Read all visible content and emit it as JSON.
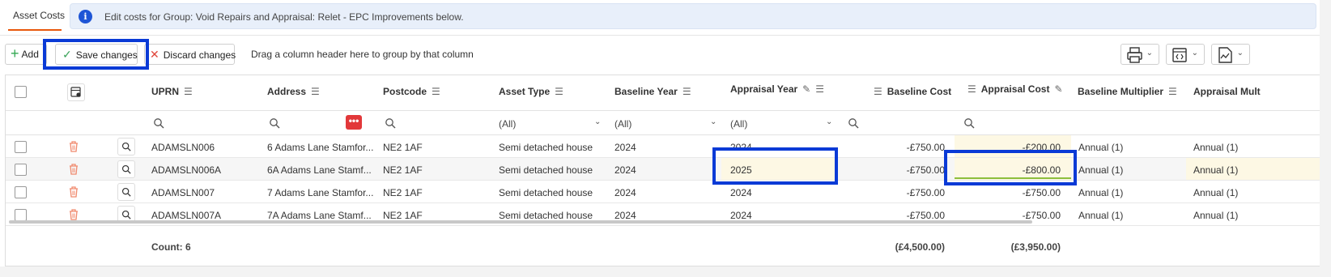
{
  "tab": {
    "label": "Asset Costs"
  },
  "banner": {
    "text": "Edit costs for Group: Void Repairs and Appraisal: Relet - EPC Improvements below.",
    "icon": "info-icon"
  },
  "toolbar": {
    "add_label": "Add",
    "save_label": "Save changes",
    "discard_label": "Discard changes",
    "group_hint": "Drag a column header here to group by that column"
  },
  "columns": {
    "uprn": "UPRN",
    "address": "Address",
    "postcode": "Postcode",
    "asset_type": "Asset Type",
    "baseline_year": "Baseline Year",
    "appraisal_year": "Appraisal Year",
    "baseline_cost": "Baseline Cost",
    "appraisal_cost": "Appraisal Cost",
    "baseline_multiplier": "Baseline Multiplier",
    "appraisal_multiplier": "Appraisal Mult"
  },
  "filters": {
    "asset_type": "(All)",
    "baseline_year": "(All)",
    "appraisal_year": "(All)"
  },
  "rows": [
    {
      "uprn": "ADAMSLN006",
      "address": "6 Adams Lane Stamfor...",
      "postcode": "NE2 1AF",
      "asset_type": "Semi detached house",
      "baseline_year": "2024",
      "appraisal_year": "2024",
      "baseline_cost": "-£750.00",
      "appraisal_cost": "-£200.00",
      "baseline_multiplier": "Annual (1)",
      "appraisal_multiplier": "Annual (1)"
    },
    {
      "uprn": "ADAMSLN006A",
      "address": "6A Adams Lane Stamf...",
      "postcode": "NE2 1AF",
      "asset_type": "Semi detached house",
      "baseline_year": "2024",
      "appraisal_year": "2025",
      "baseline_cost": "-£750.00",
      "appraisal_cost": "-£800.00",
      "baseline_multiplier": "Annual (1)",
      "appraisal_multiplier": "Annual (1)"
    },
    {
      "uprn": "ADAMSLN007",
      "address": "7 Adams Lane Stamfor...",
      "postcode": "NE2 1AF",
      "asset_type": "Semi detached house",
      "baseline_year": "2024",
      "appraisal_year": "2024",
      "baseline_cost": "-£750.00",
      "appraisal_cost": "-£750.00",
      "baseline_multiplier": "Annual (1)",
      "appraisal_multiplier": "Annual (1)"
    },
    {
      "uprn": "ADAMSLN007A",
      "address": "7A Adams Lane Stamf...",
      "postcode": "NE2 1AF",
      "asset_type": "Semi detached house",
      "baseline_year": "2024",
      "appraisal_year": "2024",
      "baseline_cost": "-£750.00",
      "appraisal_cost": "-£750.00",
      "baseline_multiplier": "Annual (1)",
      "appraisal_multiplier": "Annual (1)"
    }
  ],
  "footer": {
    "count": "Count: 6",
    "baseline_total": "(£4,500.00)",
    "appraisal_total": "(£3,950.00)"
  },
  "colors": {
    "accent": "#e8580c",
    "highlight": "#0a3ad6",
    "edited_bg": "#fdf8e4",
    "edited_line": "#8dbf3c",
    "delete": "#f08a6e"
  }
}
